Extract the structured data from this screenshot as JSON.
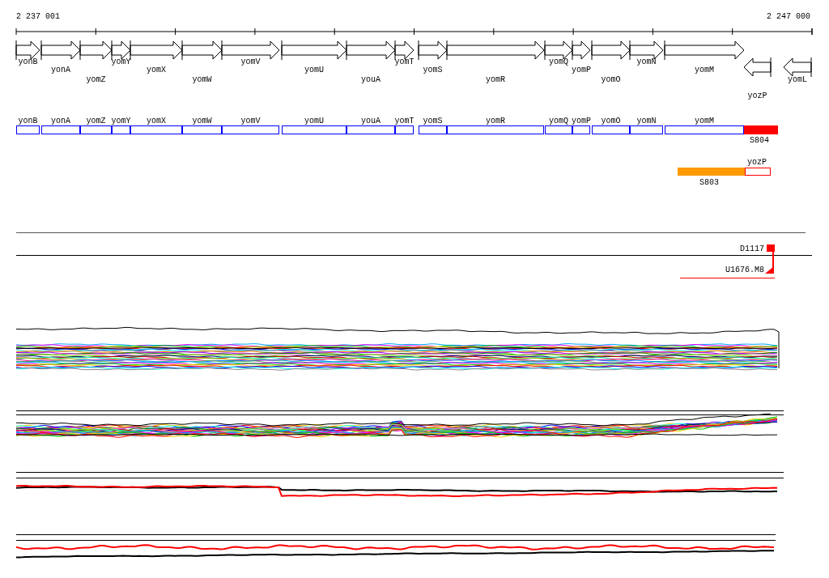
{
  "ruler": {
    "start": "2 237 001",
    "end": "2 247 000"
  },
  "genes": [
    {
      "name": "yonB",
      "kind": "forward"
    },
    {
      "name": "yonA",
      "kind": "forward"
    },
    {
      "name": "yomZ",
      "kind": "forward"
    },
    {
      "name": "yomY",
      "kind": "forward"
    },
    {
      "name": "yomX",
      "kind": "forward"
    },
    {
      "name": "yomW",
      "kind": "forward"
    },
    {
      "name": "yomV",
      "kind": "forward"
    },
    {
      "name": "yomU",
      "kind": "forward"
    },
    {
      "name": "youA",
      "kind": "forward"
    },
    {
      "name": "yomT",
      "kind": "forward"
    },
    {
      "name": "yomS",
      "kind": "forward"
    },
    {
      "name": "yomR",
      "kind": "forward"
    },
    {
      "name": "yomQ",
      "kind": "forward"
    },
    {
      "name": "yomP",
      "kind": "forward"
    },
    {
      "name": "yomO",
      "kind": "forward"
    },
    {
      "name": "yomN",
      "kind": "forward"
    },
    {
      "name": "yomM",
      "kind": "forward"
    },
    {
      "name": "yozP",
      "kind": "reverse"
    },
    {
      "name": "yomL",
      "kind": "reverse"
    }
  ],
  "gene_boxes": [
    {
      "label": "yonB"
    },
    {
      "label": "yonA"
    },
    {
      "label": "yomZ"
    },
    {
      "label": "yomY"
    },
    {
      "label": "yomX"
    },
    {
      "label": "yomW"
    },
    {
      "label": "yomV"
    },
    {
      "label": "yomU"
    },
    {
      "label": "youA"
    },
    {
      "label": "yomT"
    },
    {
      "label": "yomS"
    },
    {
      "label": "yomR"
    },
    {
      "label": "yomQ"
    },
    {
      "label": "yomP"
    },
    {
      "label": "yomO"
    },
    {
      "label": "yomN"
    },
    {
      "label": "yomM"
    }
  ],
  "features": [
    {
      "label": "S804",
      "color": "#ff0000",
      "kind": "filled"
    },
    {
      "label": "yozP",
      "color": "#ff0000",
      "kind": "outline"
    },
    {
      "label": "S803",
      "color": "#ff9900",
      "kind": "filled"
    }
  ],
  "markers": [
    {
      "label": "D1117"
    },
    {
      "label": "U1676.M8"
    }
  ]
}
